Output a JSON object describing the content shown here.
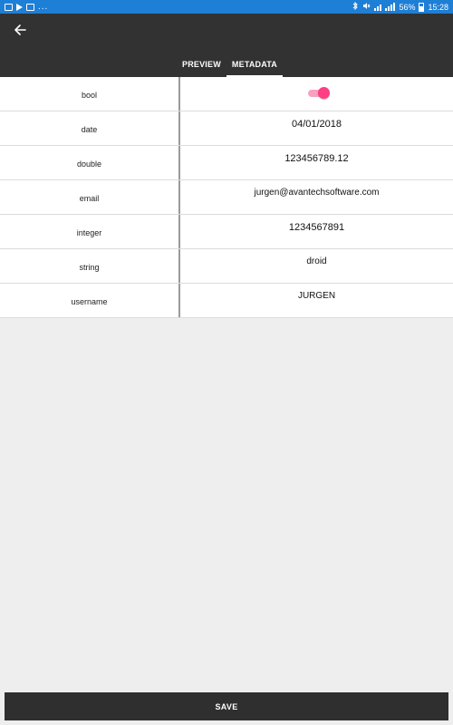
{
  "status_bar": {
    "dots": "...",
    "battery_percent": "56%",
    "time": "15:28"
  },
  "toolbar": {
    "back_icon": "arrow-left-icon"
  },
  "tabs": [
    {
      "label": "PREVIEW",
      "active": false
    },
    {
      "label": "METADATA",
      "active": true
    }
  ],
  "metadata": [
    {
      "key": "bool",
      "value": "",
      "type": "toggle",
      "checked": true
    },
    {
      "key": "date",
      "value": "04/01/2018"
    },
    {
      "key": "double",
      "value": "123456789.12"
    },
    {
      "key": "email",
      "value": "jurgen@avantechsoftware.com"
    },
    {
      "key": "integer",
      "value": "1234567891"
    },
    {
      "key": "string",
      "value": "droid"
    },
    {
      "key": "username",
      "value": "JURGEN"
    }
  ],
  "colors": {
    "status_bar": "#1e7fd6",
    "app_bar": "#323232",
    "toggle_accent": "#ff3e83",
    "save_button": "#2f2f2f"
  },
  "save_label": "SAVE"
}
